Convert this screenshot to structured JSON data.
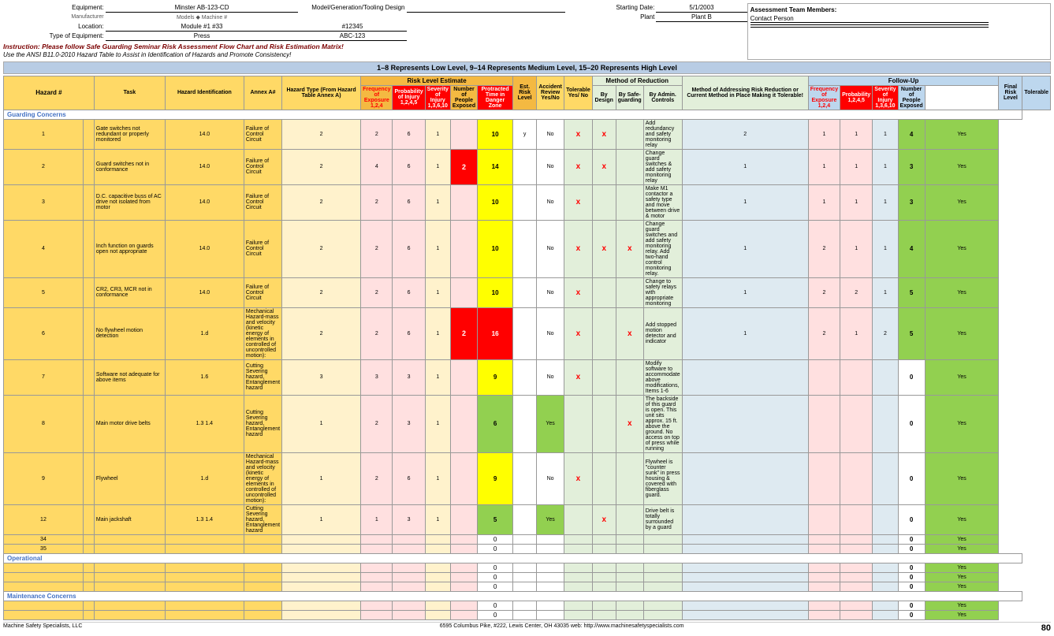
{
  "header": {
    "equipment_label": "Equipment:",
    "equipment_value": "Minster  AB-123-CD",
    "equipment_sub": "Manufacturer",
    "model_label": "Model/Generation/Tooling Design",
    "location_label": "Location:",
    "location_value": "Module #1  #33",
    "id_value": "#12345",
    "starting_date_label": "Starting Date:",
    "starting_date_value": "5/1/2003",
    "assessment_team_label": "Assessment Team Members:",
    "contact_person": "Contact Person",
    "type_label": "Type of Equipment:",
    "type_value": "Press",
    "type_id": "ABC-123",
    "plant_label": "Plant",
    "plant_value": "Plant B",
    "instruction1": "Instruction: Please follow Safe Guarding Seminar Risk Assessment Flow Chart and Risk Estimation Matrix!",
    "instruction2": "Use the ANSI B11.0-2010 Hazard Table to Assist in Identification of Hazards and Promote Consistency!",
    "level_bar": "1–8 Represents Low Level,     9–14 Represents Medium Level,     15–20 Represents High Level"
  },
  "table": {
    "sections": {
      "hazard_id": "Hazard Identification",
      "risk_est": "Risk Level Estimate",
      "method": "Method of Reduction",
      "followup": "Follow-Up"
    },
    "col_headers": {
      "hazard_num": "Hazard #",
      "task": "Task",
      "hazard_identification": "Hazard Identification",
      "annex_a": "Annex A#",
      "hazard_type": "Hazard Type (From Hazard Table Annex A)",
      "freq_exposure": "Frequency of Exposure 1,2,4",
      "prob_injury": "Probability of Injury 1,2,4,5",
      "severity": "Severity of Injury 1,3,6,10",
      "num_people": "Number of People Exposed",
      "protracted": "Protracted Time in Danger Zone",
      "est_risk": "Est. Risk Level",
      "accident_review": "Accident Review Yes/No",
      "tolerable": "Tolerable Yes/No",
      "by_design": "By Design",
      "by_safeguarding": "By Safe-guarding",
      "by_admin": "By Admin. Controls",
      "method_desc": "Method of Addressing Risk Reduction or Current Method in Place Making it Tolerable!",
      "freq2": "Frequency of Exposure 1,2,4",
      "prob2": "Probability 1,2,4,5",
      "sev2": "Severity of Injury 1,3,6,10",
      "npe2": "Number of People Exposed",
      "final_risk": "Final Risk Level",
      "tolerable2": "Tolerable"
    },
    "rows": [
      {
        "section": "guarding",
        "section_label": "Guarding Concerns",
        "items": [
          {
            "num": "1",
            "task": "Gate switches not redundant or properly monitored",
            "annex": "14.0",
            "hazard_type": "Failure of Control Circuit",
            "freq": "2",
            "prob": "2",
            "sev": "6",
            "npe": "1",
            "prot": "",
            "est_risk": "10",
            "risk_color": "yellow",
            "accident": "y",
            "tolerable": "No",
            "by_design": "x",
            "by_safe": "x",
            "by_admin": "",
            "method": "Add redundancy and safety monitoring relay",
            "freq2": "2",
            "prob2": "1",
            "sev2": "1",
            "npe2": "1",
            "final": "4",
            "final_color": "green",
            "tol2": "Yes",
            "tol2_color": "green"
          },
          {
            "num": "2",
            "task": "Guard switches not in conformance",
            "annex": "14.0",
            "hazard_type": "Failure of Control Circuit",
            "freq": "2",
            "prob": "4",
            "sev": "6",
            "npe": "1",
            "prot": "2",
            "est_risk": "14",
            "risk_color": "yellow",
            "accident": "",
            "tolerable": "No",
            "by_design": "x",
            "by_safe": "x",
            "by_admin": "",
            "method": "Change guard switches & add safety monitoring relay",
            "freq2": "1",
            "prob2": "1",
            "sev2": "1",
            "npe2": "1",
            "final": "3",
            "final_color": "green",
            "tol2": "Yes",
            "tol2_color": "green"
          },
          {
            "num": "3",
            "task": "D.C. capacitive buss of AC drive not isolated from motor",
            "annex": "14.0",
            "hazard_type": "Failure of Control Circuit",
            "freq": "2",
            "prob": "2",
            "sev": "6",
            "npe": "1",
            "prot": "",
            "est_risk": "10",
            "risk_color": "yellow",
            "accident": "",
            "tolerable": "No",
            "by_design": "x",
            "by_safe": "",
            "by_admin": "",
            "method": "Make M1 contactor a safety type and move between drive & motor",
            "freq2": "1",
            "prob2": "1",
            "sev2": "1",
            "npe2": "1",
            "final": "3",
            "final_color": "green",
            "tol2": "Yes",
            "tol2_color": "green"
          },
          {
            "num": "4",
            "task": "Inch function on guards open not appropriate",
            "annex": "14.0",
            "hazard_type": "Failure of Control Circuit",
            "freq": "2",
            "prob": "2",
            "sev": "6",
            "npe": "1",
            "prot": "",
            "est_risk": "10",
            "risk_color": "yellow",
            "accident": "",
            "tolerable": "No",
            "by_design": "x",
            "by_safe": "x",
            "by_admin": "x",
            "method": "Change guard switches and add safety monitoring relay. Add two-hand control monitoring relay.",
            "freq2": "1",
            "prob2": "2",
            "sev2": "1",
            "npe2": "1",
            "final": "4",
            "final_color": "green",
            "tol2": "Yes",
            "tol2_color": "green"
          },
          {
            "num": "5",
            "task": "CR2, CR3, MCR not in conformance",
            "annex": "14.0",
            "hazard_type": "Failure of Control Circuit",
            "freq": "2",
            "prob": "2",
            "sev": "6",
            "npe": "1",
            "prot": "",
            "est_risk": "10",
            "risk_color": "yellow",
            "accident": "",
            "tolerable": "No",
            "by_design": "x",
            "by_safe": "",
            "by_admin": "",
            "method": "Change to safety relays with appropriate monitoring",
            "freq2": "1",
            "prob2": "2",
            "sev2": "2",
            "npe2": "1",
            "final": "5",
            "final_color": "green",
            "tol2": "Yes",
            "tol2_color": "green"
          },
          {
            "num": "6",
            "task": "No flywheel motion detection",
            "annex": "1.d",
            "hazard_type": "Mechanical Hazard-mass and velocity (kinetic energy of elements in controlled of uncontrolled motion):",
            "freq": "2",
            "prob": "2",
            "sev": "6",
            "npe": "1",
            "prot": "2",
            "est_risk": "16",
            "risk_color": "red",
            "accident": "",
            "tolerable": "No",
            "by_design": "x",
            "by_safe": "",
            "by_admin": "x",
            "method": "Add stopped motion detector and indicator",
            "freq2": "1",
            "prob2": "2",
            "sev2": "1",
            "npe2": "2",
            "final": "5",
            "final_color": "green",
            "tol2": "Yes",
            "tol2_color": "green"
          },
          {
            "num": "7",
            "task": "Software not adequate for above items",
            "annex": "1.6",
            "hazard_type": "Cutting Severing hazard, Entanglement hazard",
            "freq": "3",
            "prob": "3",
            "sev": "3",
            "npe": "1",
            "prot": "",
            "est_risk": "9",
            "risk_color": "yellow",
            "accident": "",
            "tolerable": "No",
            "by_design": "x",
            "by_safe": "",
            "by_admin": "",
            "method": "Modify software to accommodate above modifications, Items 1-6",
            "freq2": "",
            "prob2": "",
            "sev2": "",
            "npe2": "",
            "final": "0",
            "final_color": "none",
            "tol2": "Yes",
            "tol2_color": "green"
          },
          {
            "num": "8",
            "task": "Main motor drive belts",
            "annex": "1.3\n1.4",
            "hazard_type": "Cutting Severing hazard, Entanglement hazard",
            "freq": "1",
            "prob": "2",
            "sev": "3",
            "npe": "1",
            "prot": "",
            "est_risk": "6",
            "risk_color": "green",
            "accident": "",
            "tolerable": "Yes",
            "by_design": "",
            "by_safe": "",
            "by_admin": "x",
            "method": "The backside of this guard is open. This unit sits approx. 15 ft. above the ground. No access on top of press while running",
            "freq2": "",
            "prob2": "",
            "sev2": "",
            "npe2": "",
            "final": "0",
            "final_color": "none",
            "tol2": "Yes",
            "tol2_color": "green"
          },
          {
            "num": "9",
            "task": "Flywheel",
            "annex": "1.d",
            "hazard_type": "Mechanical Hazard-mass and velocity (kinetic energy of elements in controlled of uncontrolled motion):",
            "freq": "1",
            "prob": "2",
            "sev": "6",
            "npe": "1",
            "prot": "",
            "est_risk": "9",
            "risk_color": "yellow",
            "accident": "",
            "tolerable": "No",
            "by_design": "x",
            "by_safe": "",
            "by_admin": "",
            "method": "Flywheel is \"counter sunk\" in press housing & covered with fiberglass guard.",
            "freq2": "",
            "prob2": "",
            "sev2": "",
            "npe2": "",
            "final": "0",
            "final_color": "none",
            "tol2": "Yes",
            "tol2_color": "green"
          },
          {
            "num": "12",
            "task": "Main jackshaft",
            "annex": "1.3\n1.4",
            "hazard_type": "Cutting Severing hazard, Entanglement hazard",
            "freq": "1",
            "prob": "1",
            "sev": "3",
            "npe": "1",
            "prot": "",
            "est_risk": "5",
            "risk_color": "green",
            "accident": "",
            "tolerable": "Yes",
            "by_design": "",
            "by_safe": "x",
            "by_admin": "",
            "method": "Drive belt is totally surrounded by a guard",
            "freq2": "",
            "prob2": "",
            "sev2": "",
            "npe2": "",
            "final": "0",
            "final_color": "none",
            "tol2": "Yes",
            "tol2_color": "green"
          },
          {
            "num": "34",
            "task": "",
            "annex": "",
            "hazard_type": "",
            "freq": "",
            "prob": "",
            "sev": "",
            "npe": "",
            "prot": "",
            "est_risk": "0",
            "risk_color": "none",
            "accident": "",
            "tolerable": "",
            "by_design": "",
            "by_safe": "",
            "by_admin": "",
            "method": "",
            "freq2": "",
            "prob2": "",
            "sev2": "",
            "npe2": "",
            "final": "0",
            "final_color": "none",
            "tol2": "Yes",
            "tol2_color": "green"
          },
          {
            "num": "35",
            "task": "",
            "annex": "",
            "hazard_type": "",
            "freq": "",
            "prob": "",
            "sev": "",
            "npe": "",
            "prot": "",
            "est_risk": "0",
            "risk_color": "none",
            "accident": "",
            "tolerable": "",
            "by_design": "",
            "by_safe": "",
            "by_admin": "",
            "method": "",
            "freq2": "",
            "prob2": "",
            "sev2": "",
            "npe2": "",
            "final": "0",
            "final_color": "none",
            "tol2": "Yes",
            "tol2_color": "green"
          }
        ]
      },
      {
        "section": "operational",
        "section_label": "Operational",
        "items": [
          {
            "num": "",
            "task": "",
            "annex": "",
            "hazard_type": "",
            "freq": "",
            "prob": "",
            "sev": "",
            "npe": "",
            "prot": "",
            "est_risk": "0",
            "risk_color": "none",
            "accident": "",
            "tolerable": "",
            "by_design": "",
            "by_safe": "",
            "by_admin": "",
            "method": "",
            "freq2": "",
            "prob2": "",
            "sev2": "",
            "npe2": "",
            "final": "0",
            "final_color": "none",
            "tol2": "Yes",
            "tol2_color": "green"
          },
          {
            "num": "",
            "task": "",
            "annex": "",
            "hazard_type": "",
            "freq": "",
            "prob": "",
            "sev": "",
            "npe": "",
            "prot": "",
            "est_risk": "0",
            "risk_color": "none",
            "accident": "",
            "tolerable": "",
            "by_design": "",
            "by_safe": "",
            "by_admin": "",
            "method": "",
            "freq2": "",
            "prob2": "",
            "sev2": "",
            "npe2": "",
            "final": "0",
            "final_color": "none",
            "tol2": "Yes",
            "tol2_color": "green"
          },
          {
            "num": "",
            "task": "",
            "annex": "",
            "hazard_type": "",
            "freq": "",
            "prob": "",
            "sev": "",
            "npe": "",
            "prot": "",
            "est_risk": "0",
            "risk_color": "none",
            "accident": "",
            "tolerable": "",
            "by_design": "",
            "by_safe": "",
            "by_admin": "",
            "method": "",
            "freq2": "",
            "prob2": "",
            "sev2": "",
            "npe2": "",
            "final": "0",
            "final_color": "none",
            "tol2": "Yes",
            "tol2_color": "green"
          }
        ]
      },
      {
        "section": "maintenance",
        "section_label": "Maintenance Concerns",
        "items": [
          {
            "num": "",
            "task": "",
            "annex": "",
            "hazard_type": "",
            "freq": "",
            "prob": "",
            "sev": "",
            "npe": "",
            "prot": "",
            "est_risk": "0",
            "risk_color": "none",
            "accident": "",
            "tolerable": "",
            "by_design": "",
            "by_safe": "",
            "by_admin": "",
            "method": "",
            "freq2": "",
            "prob2": "",
            "sev2": "",
            "npe2": "",
            "final": "0",
            "final_color": "none",
            "tol2": "Yes",
            "tol2_color": "green"
          },
          {
            "num": "",
            "task": "",
            "annex": "",
            "hazard_type": "",
            "freq": "",
            "prob": "",
            "sev": "",
            "npe": "",
            "prot": "",
            "est_risk": "0",
            "risk_color": "none",
            "accident": "",
            "tolerable": "",
            "by_design": "",
            "by_safe": "",
            "by_admin": "",
            "method": "",
            "freq2": "",
            "prob2": "",
            "sev2": "",
            "npe2": "",
            "final": "0",
            "final_color": "none",
            "tol2": "Yes",
            "tol2_color": "green"
          }
        ]
      }
    ]
  },
  "footer": {
    "company": "Machine Safety Specialists, LLC",
    "address": "6595 Columbus Pike, #222, Lewis Center, OH 43035  web: http://www.machinesafetyspecialists.com",
    "page_num": "80"
  }
}
